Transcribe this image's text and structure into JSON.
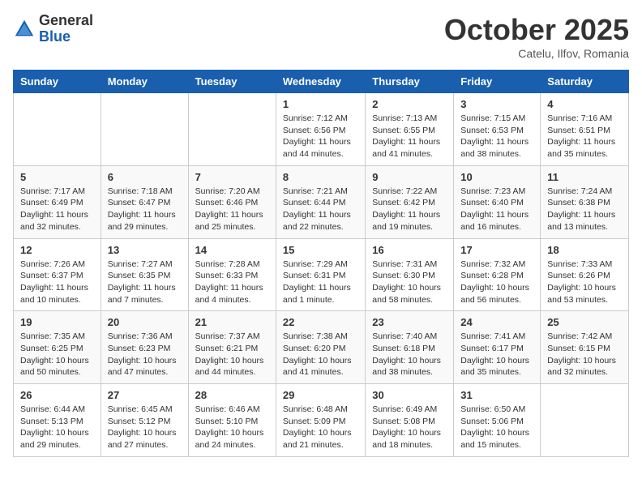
{
  "header": {
    "logo_general": "General",
    "logo_blue": "Blue",
    "month_title": "October 2025",
    "location": "Catelu, Ilfov, Romania"
  },
  "days_of_week": [
    "Sunday",
    "Monday",
    "Tuesday",
    "Wednesday",
    "Thursday",
    "Friday",
    "Saturday"
  ],
  "weeks": [
    [
      {
        "day": "",
        "info": ""
      },
      {
        "day": "",
        "info": ""
      },
      {
        "day": "",
        "info": ""
      },
      {
        "day": "1",
        "info": "Sunrise: 7:12 AM\nSunset: 6:56 PM\nDaylight: 11 hours and 44 minutes."
      },
      {
        "day": "2",
        "info": "Sunrise: 7:13 AM\nSunset: 6:55 PM\nDaylight: 11 hours and 41 minutes."
      },
      {
        "day": "3",
        "info": "Sunrise: 7:15 AM\nSunset: 6:53 PM\nDaylight: 11 hours and 38 minutes."
      },
      {
        "day": "4",
        "info": "Sunrise: 7:16 AM\nSunset: 6:51 PM\nDaylight: 11 hours and 35 minutes."
      }
    ],
    [
      {
        "day": "5",
        "info": "Sunrise: 7:17 AM\nSunset: 6:49 PM\nDaylight: 11 hours and 32 minutes."
      },
      {
        "day": "6",
        "info": "Sunrise: 7:18 AM\nSunset: 6:47 PM\nDaylight: 11 hours and 29 minutes."
      },
      {
        "day": "7",
        "info": "Sunrise: 7:20 AM\nSunset: 6:46 PM\nDaylight: 11 hours and 25 minutes."
      },
      {
        "day": "8",
        "info": "Sunrise: 7:21 AM\nSunset: 6:44 PM\nDaylight: 11 hours and 22 minutes."
      },
      {
        "day": "9",
        "info": "Sunrise: 7:22 AM\nSunset: 6:42 PM\nDaylight: 11 hours and 19 minutes."
      },
      {
        "day": "10",
        "info": "Sunrise: 7:23 AM\nSunset: 6:40 PM\nDaylight: 11 hours and 16 minutes."
      },
      {
        "day": "11",
        "info": "Sunrise: 7:24 AM\nSunset: 6:38 PM\nDaylight: 11 hours and 13 minutes."
      }
    ],
    [
      {
        "day": "12",
        "info": "Sunrise: 7:26 AM\nSunset: 6:37 PM\nDaylight: 11 hours and 10 minutes."
      },
      {
        "day": "13",
        "info": "Sunrise: 7:27 AM\nSunset: 6:35 PM\nDaylight: 11 hours and 7 minutes."
      },
      {
        "day": "14",
        "info": "Sunrise: 7:28 AM\nSunset: 6:33 PM\nDaylight: 11 hours and 4 minutes."
      },
      {
        "day": "15",
        "info": "Sunrise: 7:29 AM\nSunset: 6:31 PM\nDaylight: 11 hours and 1 minute."
      },
      {
        "day": "16",
        "info": "Sunrise: 7:31 AM\nSunset: 6:30 PM\nDaylight: 10 hours and 58 minutes."
      },
      {
        "day": "17",
        "info": "Sunrise: 7:32 AM\nSunset: 6:28 PM\nDaylight: 10 hours and 56 minutes."
      },
      {
        "day": "18",
        "info": "Sunrise: 7:33 AM\nSunset: 6:26 PM\nDaylight: 10 hours and 53 minutes."
      }
    ],
    [
      {
        "day": "19",
        "info": "Sunrise: 7:35 AM\nSunset: 6:25 PM\nDaylight: 10 hours and 50 minutes."
      },
      {
        "day": "20",
        "info": "Sunrise: 7:36 AM\nSunset: 6:23 PM\nDaylight: 10 hours and 47 minutes."
      },
      {
        "day": "21",
        "info": "Sunrise: 7:37 AM\nSunset: 6:21 PM\nDaylight: 10 hours and 44 minutes."
      },
      {
        "day": "22",
        "info": "Sunrise: 7:38 AM\nSunset: 6:20 PM\nDaylight: 10 hours and 41 minutes."
      },
      {
        "day": "23",
        "info": "Sunrise: 7:40 AM\nSunset: 6:18 PM\nDaylight: 10 hours and 38 minutes."
      },
      {
        "day": "24",
        "info": "Sunrise: 7:41 AM\nSunset: 6:17 PM\nDaylight: 10 hours and 35 minutes."
      },
      {
        "day": "25",
        "info": "Sunrise: 7:42 AM\nSunset: 6:15 PM\nDaylight: 10 hours and 32 minutes."
      }
    ],
    [
      {
        "day": "26",
        "info": "Sunrise: 6:44 AM\nSunset: 5:13 PM\nDaylight: 10 hours and 29 minutes."
      },
      {
        "day": "27",
        "info": "Sunrise: 6:45 AM\nSunset: 5:12 PM\nDaylight: 10 hours and 27 minutes."
      },
      {
        "day": "28",
        "info": "Sunrise: 6:46 AM\nSunset: 5:10 PM\nDaylight: 10 hours and 24 minutes."
      },
      {
        "day": "29",
        "info": "Sunrise: 6:48 AM\nSunset: 5:09 PM\nDaylight: 10 hours and 21 minutes."
      },
      {
        "day": "30",
        "info": "Sunrise: 6:49 AM\nSunset: 5:08 PM\nDaylight: 10 hours and 18 minutes."
      },
      {
        "day": "31",
        "info": "Sunrise: 6:50 AM\nSunset: 5:06 PM\nDaylight: 10 hours and 15 minutes."
      },
      {
        "day": "",
        "info": ""
      }
    ]
  ]
}
